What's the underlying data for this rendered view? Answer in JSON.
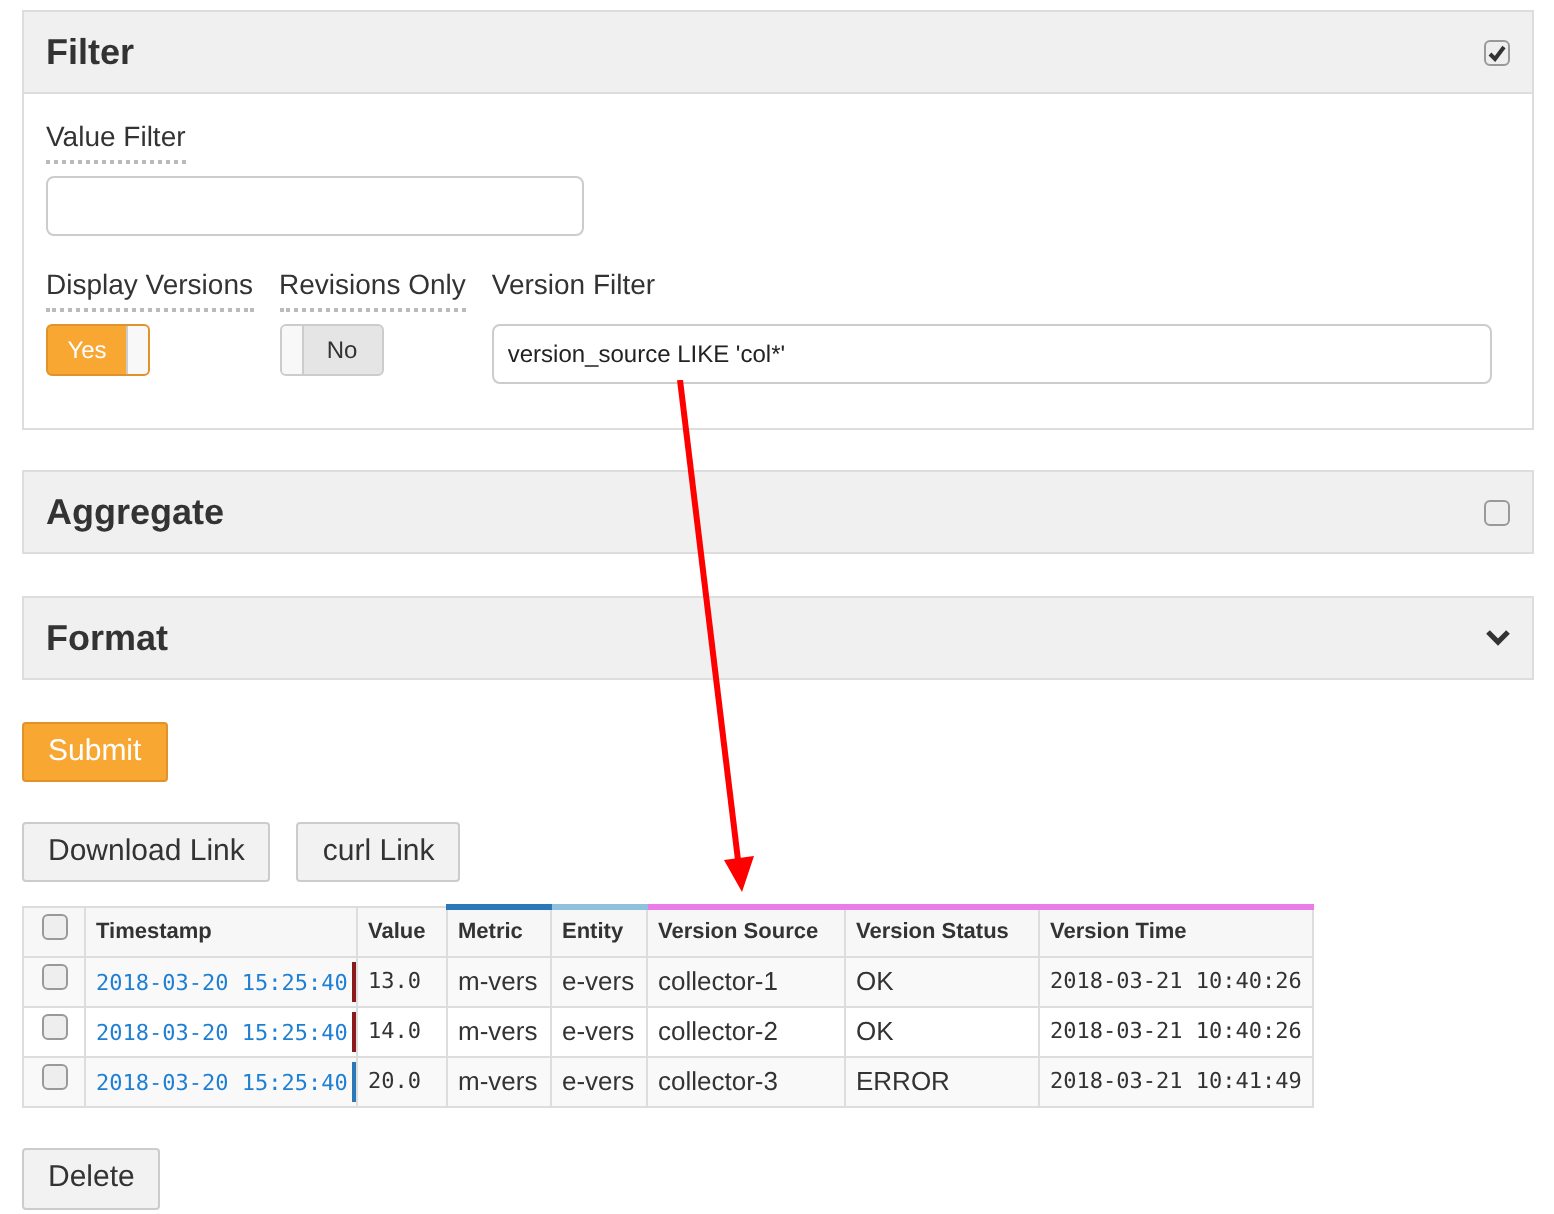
{
  "panels": [
    {
      "title": "Filter",
      "kind": "checkbox",
      "checked": true
    },
    {
      "title": "Aggregate",
      "kind": "checkbox",
      "checked": false
    },
    {
      "title": "Format",
      "kind": "collapse",
      "expanded": false
    }
  ],
  "filter": {
    "value_filter": {
      "label": "Value Filter"
    },
    "display_versions": {
      "label": "Display Versions",
      "on": true,
      "text": "Yes"
    },
    "revisions_only": {
      "label": "Revisions Only",
      "on": false,
      "text": "No"
    },
    "version_filter": {
      "label": "Version Filter",
      "value": "version_source LIKE 'col*'"
    }
  },
  "submit": "Submit",
  "link_buttons": [
    "Download Link",
    "curl Link"
  ],
  "table": {
    "all_checked": false,
    "columns": [
      {
        "label": "Timestamp"
      },
      {
        "label": "Value"
      },
      {
        "label": "Metric",
        "color": "#2a78b8"
      },
      {
        "label": "Entity",
        "color": "#8fc0dc"
      },
      {
        "label": "Version Source",
        "color": "#e97ce6"
      },
      {
        "label": "Version Status",
        "color": "#e97ce6"
      },
      {
        "label": "Version Time",
        "color": "#e97ce6"
      }
    ],
    "rows": [
      {
        "checked": false,
        "color": "#8b1a1a",
        "cells": [
          "2018-03-20 15:25:40",
          "13.0",
          "m-vers",
          "e-vers",
          "collector-1",
          "OK",
          "2018-03-21 10:40:26"
        ]
      },
      {
        "checked": false,
        "color": "#8b1a1a",
        "cells": [
          "2018-03-20 15:25:40",
          "14.0",
          "m-vers",
          "e-vers",
          "collector-2",
          "OK",
          "2018-03-21 10:40:26"
        ]
      },
      {
        "checked": false,
        "color": "#2a78b8",
        "cells": [
          "2018-03-20 15:25:40",
          "20.0",
          "m-vers",
          "e-vers",
          "collector-3",
          "ERROR",
          "2018-03-21 10:41:49"
        ]
      }
    ]
  },
  "delete": "Delete"
}
